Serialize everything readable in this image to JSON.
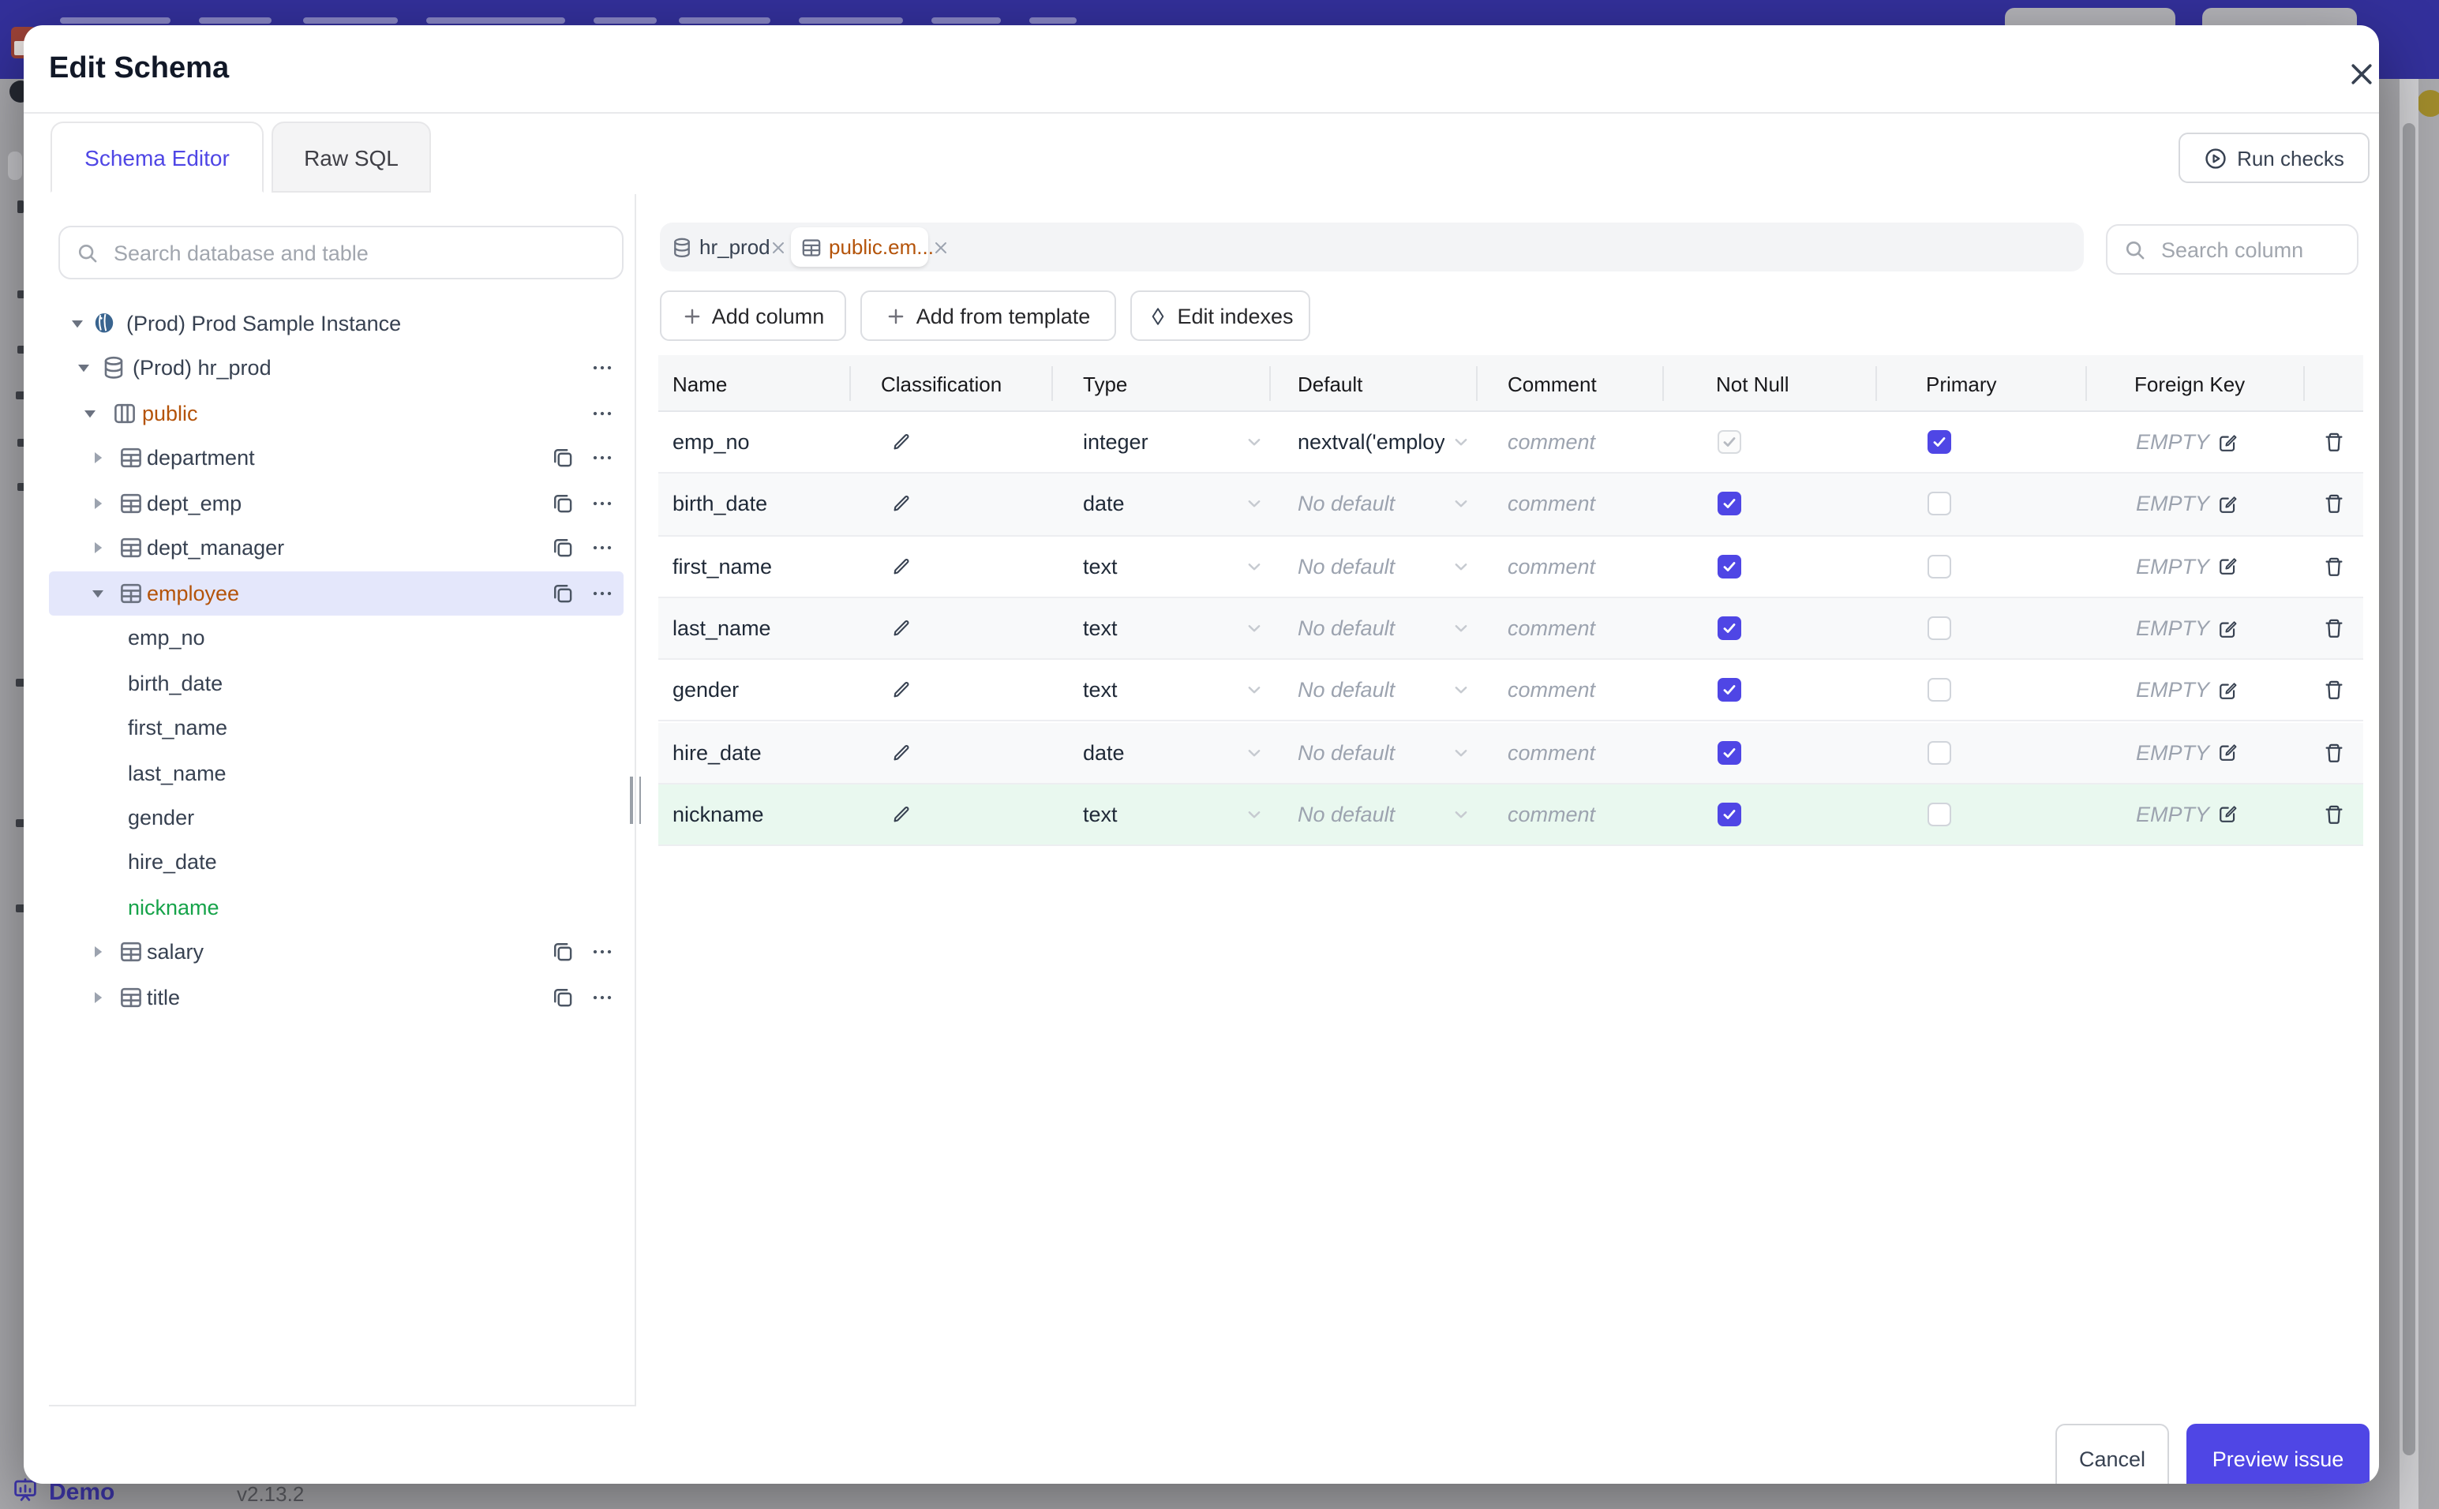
{
  "chrome": {
    "demo_label": "Demo",
    "version": "v2.13.2"
  },
  "modal": {
    "title": "Edit Schema",
    "run_checks_label": "Run checks",
    "tabs": [
      {
        "label": "Schema Editor",
        "active": true
      },
      {
        "label": "Raw SQL",
        "active": false
      }
    ],
    "footer": {
      "cancel_label": "Cancel",
      "submit_label": "Preview issue"
    }
  },
  "sidebar": {
    "search_placeholder": "Search database and table",
    "tree": [
      {
        "label": "(Prod) Prod Sample Instance",
        "level": 0,
        "icon": "postgres",
        "caret": "down",
        "actions": []
      },
      {
        "label": "(Prod) hr_prod",
        "level": 1,
        "icon": "database",
        "caret": "down",
        "actions": [
          "menu"
        ]
      },
      {
        "label": "public",
        "level": 2,
        "icon": "schema",
        "caret": "down",
        "color": "orange",
        "actions": [
          "menu"
        ]
      },
      {
        "label": "department",
        "level": 3,
        "icon": "table",
        "caret": "right",
        "actions": [
          "copy",
          "menu"
        ]
      },
      {
        "label": "dept_emp",
        "level": 3,
        "icon": "table",
        "caret": "right",
        "actions": [
          "copy",
          "menu"
        ]
      },
      {
        "label": "dept_manager",
        "level": 3,
        "icon": "table",
        "caret": "right",
        "actions": [
          "copy",
          "menu"
        ]
      },
      {
        "label": "employee",
        "level": 3,
        "icon": "table",
        "caret": "down",
        "color": "orange",
        "selected": true,
        "actions": [
          "copy",
          "menu"
        ]
      },
      {
        "label": "emp_no",
        "level": 4,
        "actions": []
      },
      {
        "label": "birth_date",
        "level": 4,
        "actions": []
      },
      {
        "label": "first_name",
        "level": 4,
        "actions": []
      },
      {
        "label": "last_name",
        "level": 4,
        "actions": []
      },
      {
        "label": "gender",
        "level": 4,
        "actions": []
      },
      {
        "label": "hire_date",
        "level": 4,
        "actions": []
      },
      {
        "label": "nickname",
        "level": 4,
        "color": "green",
        "actions": []
      },
      {
        "label": "salary",
        "level": 3,
        "icon": "table",
        "caret": "right",
        "actions": [
          "copy",
          "menu"
        ]
      },
      {
        "label": "title",
        "level": 3,
        "icon": "table",
        "caret": "right",
        "actions": [
          "copy",
          "menu"
        ]
      }
    ]
  },
  "editor": {
    "chips": [
      {
        "label": "hr_prod",
        "icon": "database",
        "active": false
      },
      {
        "label": "public.em...",
        "icon": "table",
        "active": true
      }
    ],
    "search_placeholder": "Search column",
    "toolbar": [
      {
        "label": "Add column",
        "icon": "plus"
      },
      {
        "label": "Add from template",
        "icon": "plus"
      },
      {
        "label": "Edit indexes",
        "icon": "diamond"
      }
    ],
    "columns": {
      "headers": [
        "Name",
        "Classification",
        "Type",
        "Default",
        "Comment",
        "Not Null",
        "Primary",
        "Foreign Key"
      ],
      "rows": [
        {
          "name": "emp_no",
          "type": "integer",
          "default": "nextval('employ",
          "default_placeholder": false,
          "comment": "comment",
          "not_null": "checked_disabled",
          "primary": "checked",
          "foreign_key": "EMPTY",
          "highlight": false
        },
        {
          "name": "birth_date",
          "type": "date",
          "default": "No default",
          "default_placeholder": true,
          "comment": "comment",
          "not_null": "checked",
          "primary": "unchecked",
          "foreign_key": "EMPTY",
          "highlight": false
        },
        {
          "name": "first_name",
          "type": "text",
          "default": "No default",
          "default_placeholder": true,
          "comment": "comment",
          "not_null": "checked",
          "primary": "unchecked",
          "foreign_key": "EMPTY",
          "highlight": false
        },
        {
          "name": "last_name",
          "type": "text",
          "default": "No default",
          "default_placeholder": true,
          "comment": "comment",
          "not_null": "checked",
          "primary": "unchecked",
          "foreign_key": "EMPTY",
          "highlight": false
        },
        {
          "name": "gender",
          "type": "text",
          "default": "No default",
          "default_placeholder": true,
          "comment": "comment",
          "not_null": "checked",
          "primary": "unchecked",
          "foreign_key": "EMPTY",
          "highlight": false
        },
        {
          "name": "hire_date",
          "type": "date",
          "default": "No default",
          "default_placeholder": true,
          "comment": "comment",
          "not_null": "checked",
          "primary": "unchecked",
          "foreign_key": "EMPTY",
          "highlight": false
        },
        {
          "name": "nickname",
          "type": "text",
          "default": "No default",
          "default_placeholder": true,
          "comment": "comment",
          "not_null": "checked",
          "primary": "unchecked",
          "foreign_key": "EMPTY",
          "highlight": true
        }
      ]
    }
  },
  "colors": {
    "accent": "#4f46e5",
    "topbar": "#33309b",
    "orange": "#b45309",
    "green": "#16a34a",
    "green_row_bg": "#e9f8ef",
    "selected_row_bg": "#e4e7fb"
  }
}
